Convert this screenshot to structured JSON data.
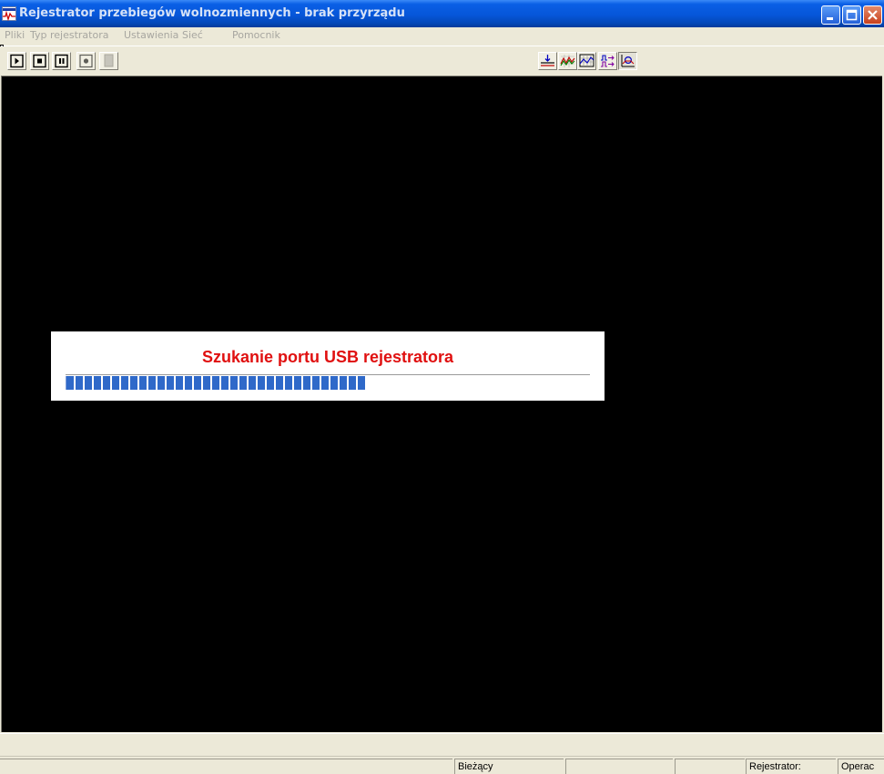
{
  "window": {
    "title": "Rejestrator przebiegów wolnozmiennych - brak przyrządu",
    "icon": "waveform-app-icon",
    "controls": [
      "minimize",
      "maximize",
      "close"
    ]
  },
  "menu": {
    "items": [
      "Pliki",
      "Typ rejestratora",
      "Ustawienia",
      "Sieć",
      "Pomocnik"
    ],
    "disabled": true
  },
  "toolbar": {
    "left_buttons": [
      "play-icon",
      "stop-icon",
      "pause-icon",
      "record-icon",
      "blank-page-icon"
    ],
    "right_buttons": [
      "marker-line-icon",
      "waveform-grid-icon",
      "chart-grid-icon",
      "signal-arrow-icon",
      "zoom-chart-icon"
    ]
  },
  "dialog": {
    "title": "Szukanie portu USB rejestratora",
    "progress_fraction": 0.57
  },
  "statusbar": {
    "panels": [
      "",
      "Bieżący",
      "",
      "",
      "Rejestrator:",
      "Operac"
    ]
  },
  "colors": {
    "title_bar": "#0656d9",
    "dialog_title": "#e01010",
    "progress": "#2f69c9",
    "plot_background": "#000000",
    "chrome": "#ece9d8"
  }
}
